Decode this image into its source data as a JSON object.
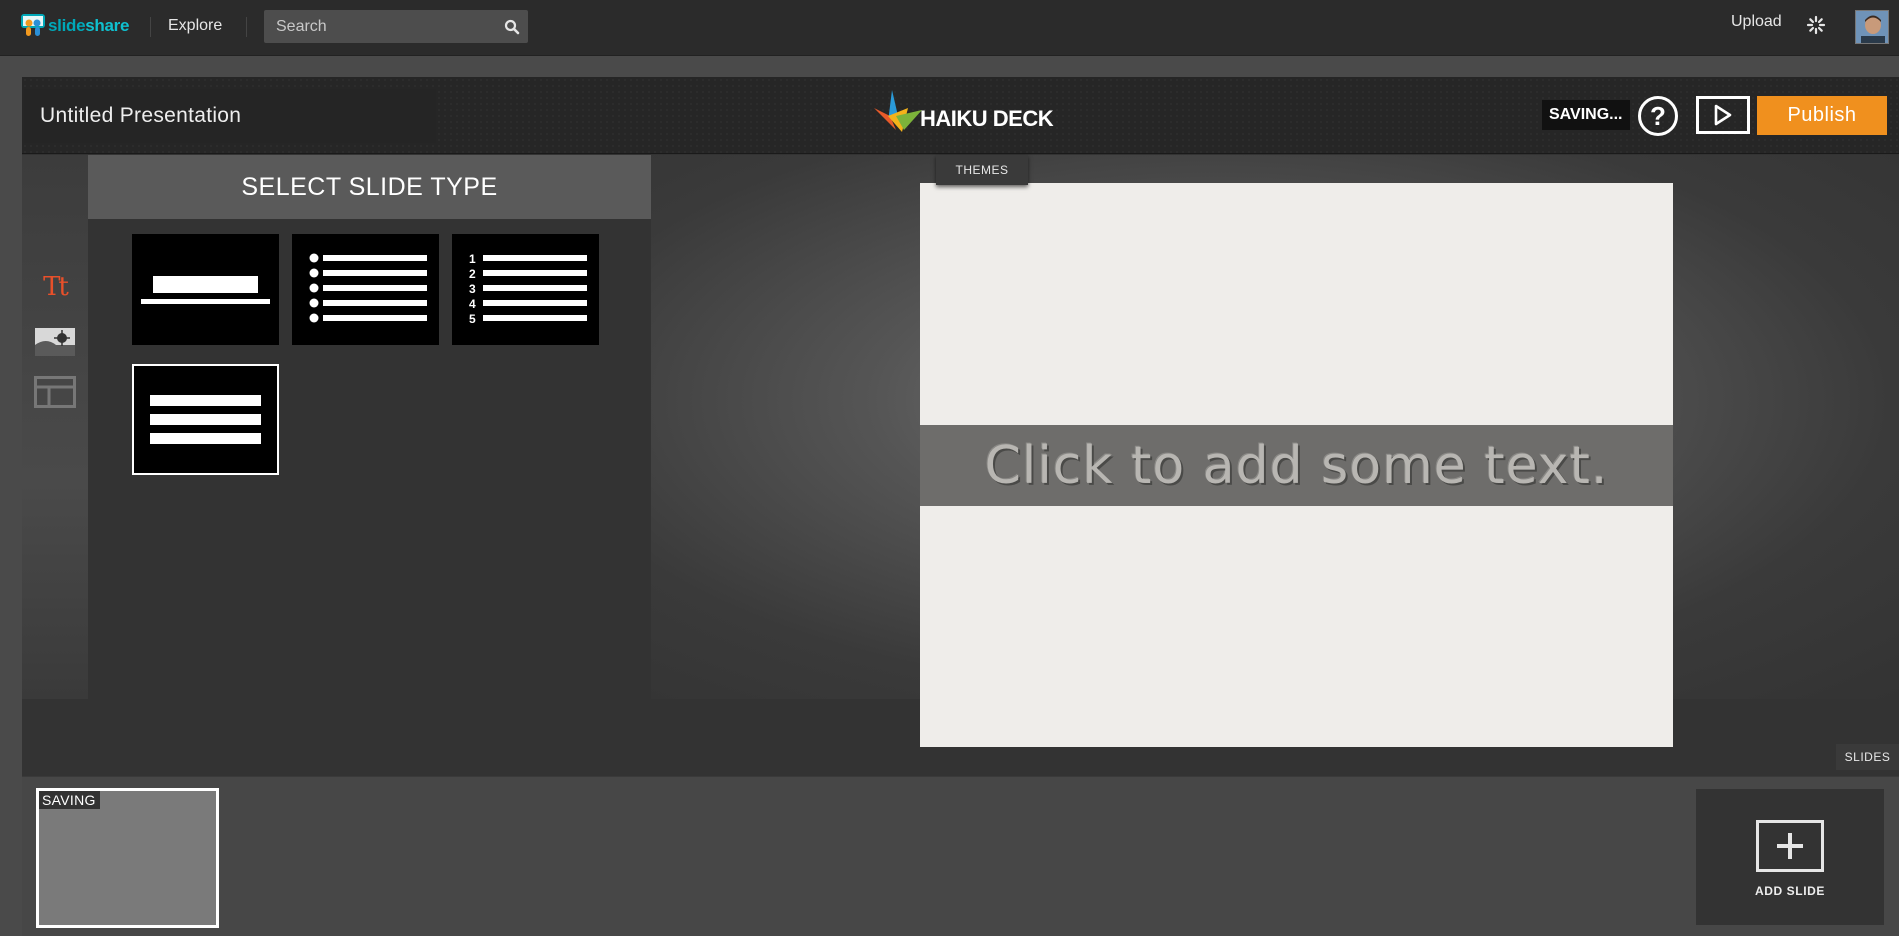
{
  "topbar": {
    "brand": {
      "part1": "slide",
      "part2": "share"
    },
    "explore_label": "Explore",
    "search": {
      "placeholder": "Search",
      "icon": "search-icon"
    },
    "upload_label": "Upload",
    "loading_icon": "spinner-icon",
    "avatar_icon": "user-avatar"
  },
  "editor": {
    "presentation_title": "Untitled Presentation",
    "brand": "HAIKU DECK",
    "status": "SAVING...",
    "help_icon": "help-icon",
    "play_icon": "play-icon",
    "publish_label": "Publish",
    "colors": {
      "publish": "#f0901e",
      "text_tab_active": "#e8502a"
    }
  },
  "rail": {
    "items": [
      {
        "name": "text-tab",
        "label": "Tt",
        "icon": "text-icon",
        "active": true
      },
      {
        "name": "image-tab",
        "icon": "image-icon",
        "active": false
      },
      {
        "name": "layout-tab",
        "icon": "layout-icon",
        "active": false
      }
    ]
  },
  "slide_type_panel": {
    "heading": "SELECT SLIDE TYPE",
    "types": [
      {
        "name": "title-slide-type",
        "selected": false
      },
      {
        "name": "bullet-list-slide-type",
        "selected": false
      },
      {
        "name": "numbered-list-slide-type",
        "numbers": [
          "1",
          "2",
          "3",
          "4",
          "5"
        ],
        "selected": false
      },
      {
        "name": "text-block-slide-type",
        "selected": true
      }
    ]
  },
  "stage": {
    "themes_label": "THEMES",
    "slide_placeholder": "Click to add some text.",
    "slides_label": "SLIDES"
  },
  "filmstrip": {
    "thumbnails": [
      {
        "label": "SAVING"
      }
    ],
    "add_slide_label": "ADD SLIDE"
  }
}
